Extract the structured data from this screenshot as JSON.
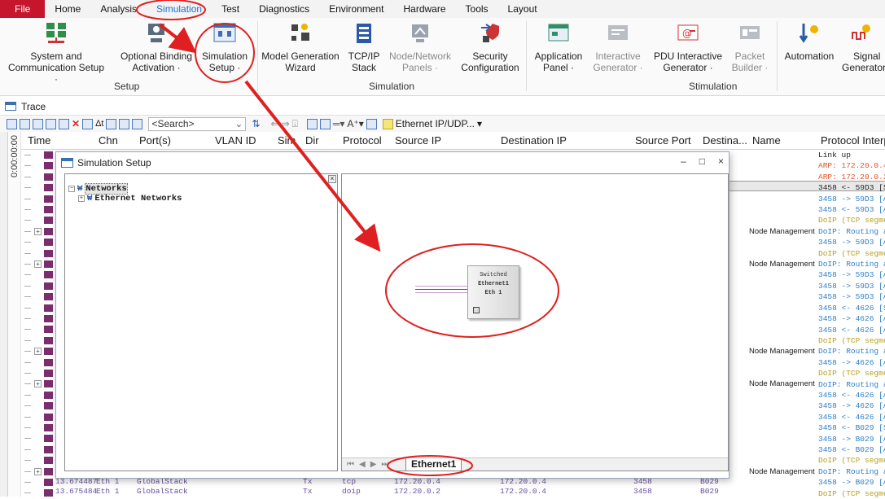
{
  "menubar": {
    "items": [
      "File",
      "Home",
      "Analysis",
      "Simulation",
      "Test",
      "Diagnostics",
      "Environment",
      "Hardware",
      "Tools",
      "Layout"
    ],
    "active": "Simulation"
  },
  "ribbon": {
    "setup_buttons": [
      {
        "line1": "System and",
        "line2": "Communication Setup ·"
      },
      {
        "line1": "Optional Binding",
        "line2": "Activation ·"
      },
      {
        "line1": "Simulation",
        "line2": "Setup ·"
      }
    ],
    "setup_group_label": "Setup",
    "simulation_buttons": [
      {
        "line1": "Model Generation",
        "line2": "Wizard"
      },
      {
        "line1": "TCP/IP",
        "line2": "Stack"
      },
      {
        "line1": "Node/Network",
        "line2": "Panels ·"
      },
      {
        "line1": "Security",
        "line2": "Configuration"
      }
    ],
    "simulation_group_label": "Simulation",
    "stimulation_buttons": [
      {
        "line1": "Application",
        "line2": "Panel ·"
      },
      {
        "line1": "Interactive",
        "line2": "Generator ·"
      },
      {
        "line1": "PDU Interactive",
        "line2": "Generator ·"
      },
      {
        "line1": "Packet",
        "line2": "Builder ·"
      }
    ],
    "stimulation_group_label": "Stimulation",
    "automation": {
      "line1": "Automation"
    },
    "signal": {
      "line1": "Signal",
      "line2": "Generators"
    }
  },
  "trace": {
    "title": "Trace",
    "search_placeholder": "<Search>",
    "filter_label": "Ethernet IP/UDP...",
    "time_label": "0:00:00:00",
    "columns": [
      "Time",
      "Chn",
      "Port(s)",
      "VLAN ID",
      "Sim",
      "Dir",
      "Protocol",
      "Source IP",
      "Destination IP",
      "Source Port",
      "Destina...",
      "Name",
      "Protocol Interp"
    ],
    "name_col": [
      {
        "row": 7,
        "text": "Node Management"
      },
      {
        "row": 10,
        "text": "Node Management"
      },
      {
        "row": 18,
        "text": "Node Management"
      },
      {
        "row": 21,
        "text": "Node Management"
      },
      {
        "row": 29,
        "text": "Node Management"
      }
    ],
    "protocol_lines": [
      {
        "text": "Link up",
        "color": "#222222"
      },
      {
        "text": "ARP: 172.20.0.4",
        "color": "#e0542a"
      },
      {
        "text": "ARP: 172.20.0.2",
        "color": "#e0542a"
      },
      {
        "text": "3458 <- 59D3 [SY",
        "color": "#222222"
      },
      {
        "text": "3458 -> 59D3 [AC",
        "color": "#2f7fc8"
      },
      {
        "text": "3458 <- 59D3 [AC",
        "color": "#2f7fc8"
      },
      {
        "text": "DoIP (TCP segmen",
        "color": "#b8a020"
      },
      {
        "text": "DoIP: Routing ac",
        "color": "#2f7fc8"
      },
      {
        "text": "3458 -> 59D3 [AC",
        "color": "#2f7fc8"
      },
      {
        "text": "DoIP (TCP segmen",
        "color": "#b8a020"
      },
      {
        "text": "DoIP: Routing ac",
        "color": "#2f7fc8"
      },
      {
        "text": "3458 -> 59D3 [AC",
        "color": "#2f7fc8"
      },
      {
        "text": "3458 -> 59D3 [AC",
        "color": "#2f7fc8"
      },
      {
        "text": "3458 -> 59D3 [AC",
        "color": "#2f7fc8"
      },
      {
        "text": "3458 <- 4626 [SY",
        "color": "#2f7fc8"
      },
      {
        "text": "3458 -> 4626 [AC",
        "color": "#2f7fc8"
      },
      {
        "text": "3458 <- 4626 [AC",
        "color": "#2f7fc8"
      },
      {
        "text": "DoIP (TCP segmen",
        "color": "#b8a020"
      },
      {
        "text": "DoIP: Routing ac",
        "color": "#2f7fc8"
      },
      {
        "text": "3458 -> 4626 [AC",
        "color": "#2f7fc8"
      },
      {
        "text": "DoIP (TCP segmen",
        "color": "#b8a020"
      },
      {
        "text": "DoIP: Routing ac",
        "color": "#2f7fc8"
      },
      {
        "text": "3458 <- 4626 [AC",
        "color": "#2f7fc8"
      },
      {
        "text": "3458 -> 4626 [AC",
        "color": "#2f7fc8"
      },
      {
        "text": "3458 <- 4626 [AC",
        "color": "#2f7fc8"
      },
      {
        "text": "3458 <- B029 [SY",
        "color": "#2f7fc8"
      },
      {
        "text": "3458 -> B029 [AC",
        "color": "#2f7fc8"
      },
      {
        "text": "3458 <- B029 [AC",
        "color": "#2f7fc8"
      },
      {
        "text": "DoIP (TCP segmen",
        "color": "#b8a020"
      },
      {
        "text": "DoIP: Routing ac",
        "color": "#2f7fc8"
      },
      {
        "text": "3458 -> B029 [AC",
        "color": "#2f7fc8"
      },
      {
        "text": "DoIP (TCP segmen",
        "color": "#b8a020"
      }
    ],
    "bottom_rows": [
      {
        "time": "13.674487",
        "chn": "Eth 1",
        "port": "GlobalStack",
        "dir": "Tx",
        "protocol": "tcp",
        "src_ip": "172.20.0.4",
        "dst_ip": "172.20.0.4",
        "src_port": "3458",
        "dst_port": "B029"
      },
      {
        "time": "13.675484",
        "chn": "Eth 1",
        "port": "GlobalStack",
        "dir": "Tx",
        "protocol": "doip",
        "src_ip": "172.20.0.2",
        "dst_ip": "172.20.0.4",
        "src_port": "3458",
        "dst_port": "B029"
      }
    ]
  },
  "dialog": {
    "title": "Simulation Setup",
    "ctrl_minimize": "–",
    "ctrl_maximize": "□",
    "ctrl_close": "×",
    "tree": {
      "root": "Networks",
      "child": "Ethernet Networks"
    },
    "node": {
      "line1": "Switched",
      "line2": "Ethernet1",
      "line3": "Eth 1"
    },
    "tab_label": "Ethernet1"
  },
  "colors": {
    "file_menu": "#c5162e",
    "active_menu": "#1f6fd0",
    "annotation": "#e02020"
  }
}
